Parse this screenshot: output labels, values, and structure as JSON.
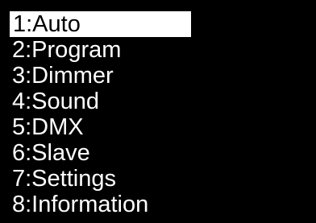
{
  "menu": {
    "selected_index": 0,
    "items": [
      {
        "label": "1:Auto"
      },
      {
        "label": "2:Program"
      },
      {
        "label": "3:Dimmer"
      },
      {
        "label": "4:Sound"
      },
      {
        "label": "5:DMX"
      },
      {
        "label": "6:Slave"
      },
      {
        "label": "7:Settings"
      },
      {
        "label": "8:Information"
      }
    ]
  },
  "colors": {
    "background": "#000000",
    "text": "#ffffff",
    "highlight_background": "#ffffff",
    "highlight_text": "#000000"
  }
}
